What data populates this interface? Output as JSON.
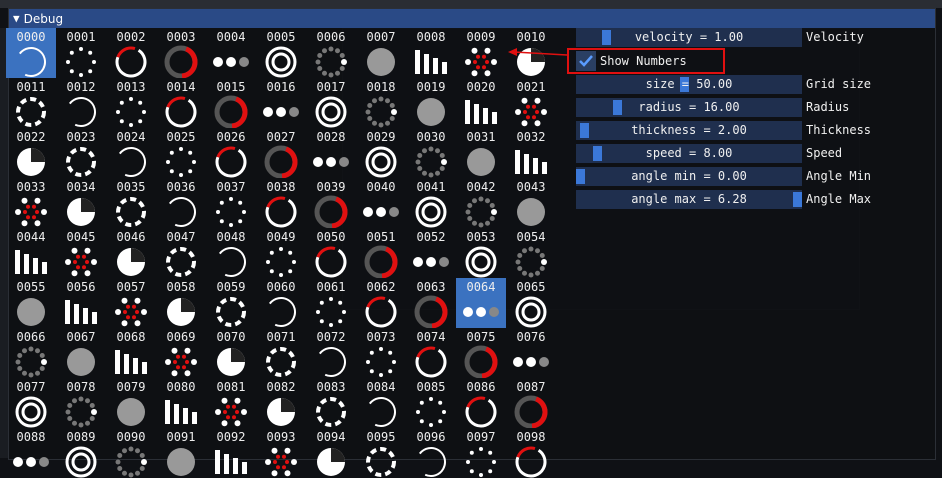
{
  "window": {
    "title": "Debug",
    "collapse_arrow": "▼"
  },
  "grid": {
    "selected": "0000",
    "highlighted": "0064",
    "cells": [
      "0000",
      "0001",
      "0002",
      "0003",
      "0004",
      "0005",
      "0006",
      "0007",
      "0008",
      "0009",
      "0010",
      "0011",
      "0012",
      "0013",
      "0014",
      "0015",
      "0016",
      "0017",
      "0018",
      "0019",
      "0020",
      "0021",
      "0022",
      "0023",
      "0024",
      "0025",
      "0026",
      "0027",
      "0028",
      "0029",
      "0030",
      "0031",
      "0032",
      "0033",
      "0034",
      "0035",
      "0036",
      "0037",
      "0038",
      "0039",
      "0040",
      "0041",
      "0042",
      "0043",
      "0044",
      "0045",
      "0046",
      "0047",
      "0048",
      "0049",
      "0050",
      "0051",
      "0052",
      "0053",
      "0054",
      "0055",
      "0056",
      "0057",
      "0058",
      "0059",
      "0060",
      "0061",
      "0062",
      "0063",
      "0064",
      "0065",
      "0066",
      "0067",
      "0068",
      "0069",
      "0070",
      "0071",
      "0072",
      "0073",
      "0074",
      "0075",
      "0076",
      "0077",
      "0078",
      "0079",
      "0080",
      "0081",
      "0082",
      "0083",
      "0084",
      "0085",
      "0086",
      "0087",
      "0088",
      "0089",
      "0090",
      "0091",
      "0092",
      "0093",
      "0094",
      "0095",
      "0096",
      "0097",
      "0098"
    ]
  },
  "controls": {
    "velocity": {
      "text": "velocity = 1.00",
      "label": "Velocity",
      "fraction": 0.12
    },
    "show_numbers": {
      "label": "Show Numbers",
      "checked": true
    },
    "size": {
      "text": "size = 50.00",
      "label": "Grid size",
      "fraction": 0.48
    },
    "radius": {
      "text": "radius = 16.00",
      "label": "Radius",
      "fraction": 0.17
    },
    "thickness": {
      "text": "thickness = 2.00",
      "label": "Thickness",
      "fraction": 0.02
    },
    "speed": {
      "text": "speed = 8.00",
      "label": "Speed",
      "fraction": 0.08
    },
    "angle_min": {
      "text": "angle min = 0.00",
      "label": "Angle Min",
      "fraction": 0.0
    },
    "angle_max": {
      "text": "angle max = 6.28",
      "label": "Angle Max",
      "fraction": 1.0
    }
  },
  "colors": {
    "accent": "#3b72c0",
    "highlight": "#e01010",
    "title": "#2a4a86"
  }
}
